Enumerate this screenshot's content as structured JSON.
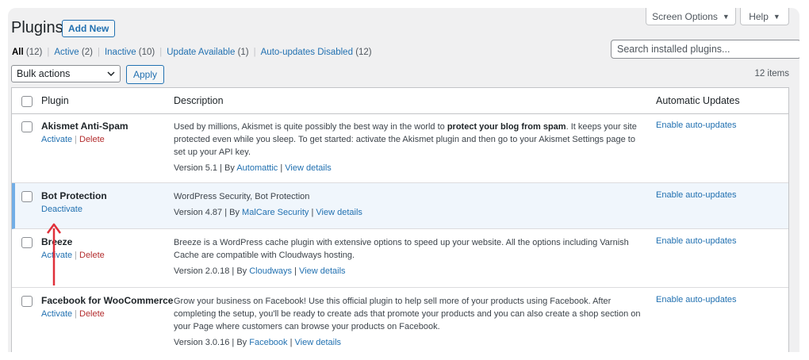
{
  "header": {
    "title": "Plugins",
    "add_new": "Add New",
    "screen_options": "Screen Options",
    "help": "Help"
  },
  "filters": [
    {
      "label": "All",
      "count": "(12)",
      "current": true
    },
    {
      "label": "Active",
      "count": "(2)"
    },
    {
      "label": "Inactive",
      "count": "(10)"
    },
    {
      "label": "Update Available",
      "count": "(1)"
    },
    {
      "label": "Auto-updates Disabled",
      "count": "(12)"
    }
  ],
  "search": {
    "placeholder": "Search installed plugins..."
  },
  "bulk": {
    "selected": "Bulk actions",
    "apply": "Apply",
    "items_count": "12 items"
  },
  "table": {
    "columns": {
      "plugin": "Plugin",
      "description": "Description",
      "auto_updates": "Automatic Updates"
    },
    "rows": [
      {
        "name": "Akismet Anti-Spam",
        "action1": "Activate",
        "action2": "Delete",
        "desc_pre": "Used by millions, Akismet is quite possibly the best way in the world to ",
        "desc_bold": "protect your blog from spam",
        "desc_post": ". It keeps your site protected even while you sleep. To get started: activate the Akismet plugin and then go to your Akismet Settings page to set up your API key.",
        "version": "Version 5.1",
        "by": "By",
        "author": "Automattic",
        "details": "View details",
        "auto": "Enable auto-updates"
      },
      {
        "name": "Bot Protection",
        "action1": "Deactivate",
        "desc_pre": "WordPress Security, Bot Protection",
        "version": "Version 4.87",
        "by": "By",
        "author": "MalCare Security",
        "details": "View details",
        "auto": "Enable auto-updates"
      },
      {
        "name": "Breeze",
        "action1": "Activate",
        "action2": "Delete",
        "desc_pre": "Breeze is a WordPress cache plugin with extensive options to speed up your website. All the options including Varnish Cache are compatible with Cloudways hosting.",
        "version": "Version 2.0.18",
        "by": "By",
        "author": "Cloudways",
        "details": "View details",
        "auto": "Enable auto-updates"
      },
      {
        "name": "Facebook for WooCommerce",
        "action1": "Activate",
        "action2": "Delete",
        "desc_pre": "Grow your business on Facebook! Use this official plugin to help sell more of your products using Facebook. After completing the setup, you'll be ready to create ads that promote your products and you can also create a shop section on your Page where customers can browse your products on Facebook.",
        "version": "Version 3.0.16",
        "by": "By",
        "author": "Facebook",
        "details": "View details",
        "auto": "Enable auto-updates"
      }
    ]
  },
  "colors": {
    "link": "#2271b1",
    "delete": "#b32d2e",
    "active_row_bg": "#f0f6fc",
    "active_border": "#72aee6",
    "annotation_arrow": "#e0303a"
  }
}
